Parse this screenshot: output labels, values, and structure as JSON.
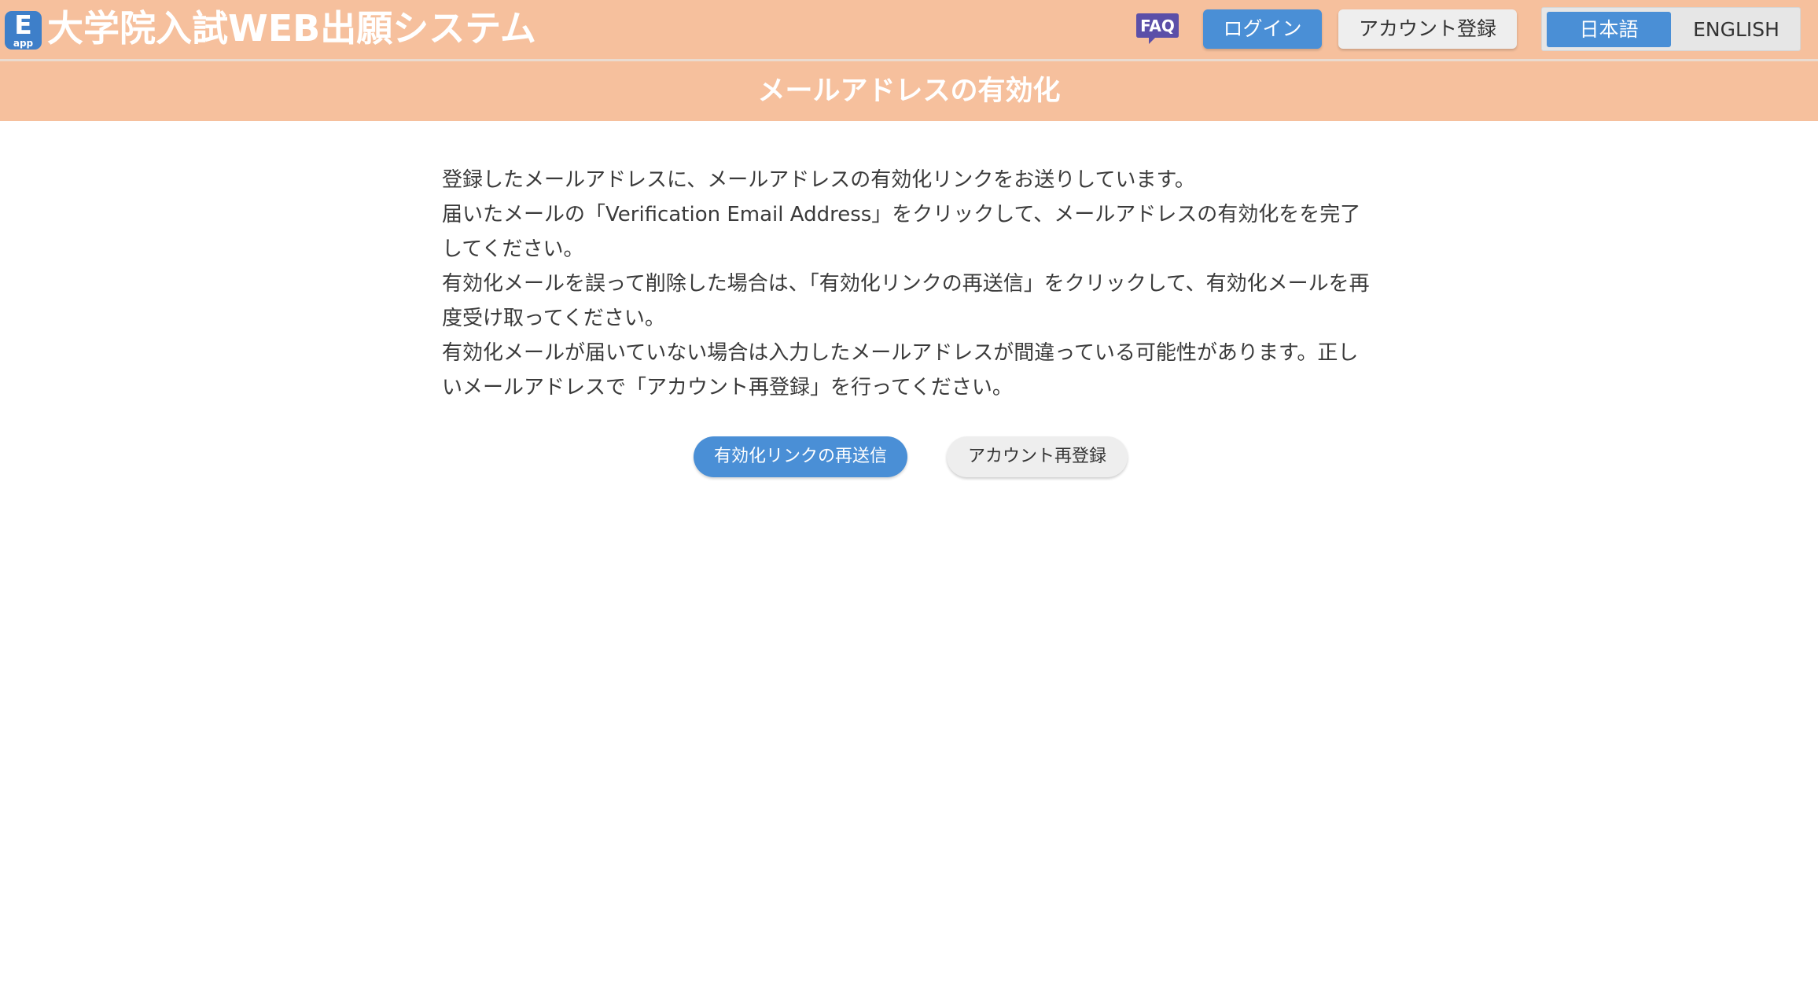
{
  "header": {
    "logo": {
      "big_letter": "E",
      "small_text": "app"
    },
    "app_title": "大学院入試WEB出願システム",
    "faq_label": "FAQ",
    "login_label": "ログイン",
    "register_label": "アカウント登録",
    "languages": [
      {
        "label": "日本語",
        "selected": true
      },
      {
        "label": "ENGLISH",
        "selected": false
      }
    ]
  },
  "page": {
    "title": "メールアドレスの有効化",
    "paragraphs": [
      "登録したメールアドレスに、メールアドレスの有効化リンクをお送りしています。",
      "届いたメールの「Verification Email Address」をクリックして、メールアドレスの有効化をを完了してください。",
      "有効化メールを誤って削除した場合は、「有効化リンクの再送信」をクリックして、有効化メールを再度受け取ってください。",
      "有効化メールが届いていない場合は入力したメールアドレスが間違っている可能性があります。正しいメールアドレスで「アカウント再登録」を行ってください。"
    ],
    "resend_label": "有効化リンクの再送信",
    "reregister_label": "アカウント再登録"
  },
  "colors": {
    "header_bg": "#f6c09d",
    "primary_button": "#4a8fd6",
    "secondary_button": "#eeeeee",
    "faq_badge": "#5b4fa8"
  }
}
